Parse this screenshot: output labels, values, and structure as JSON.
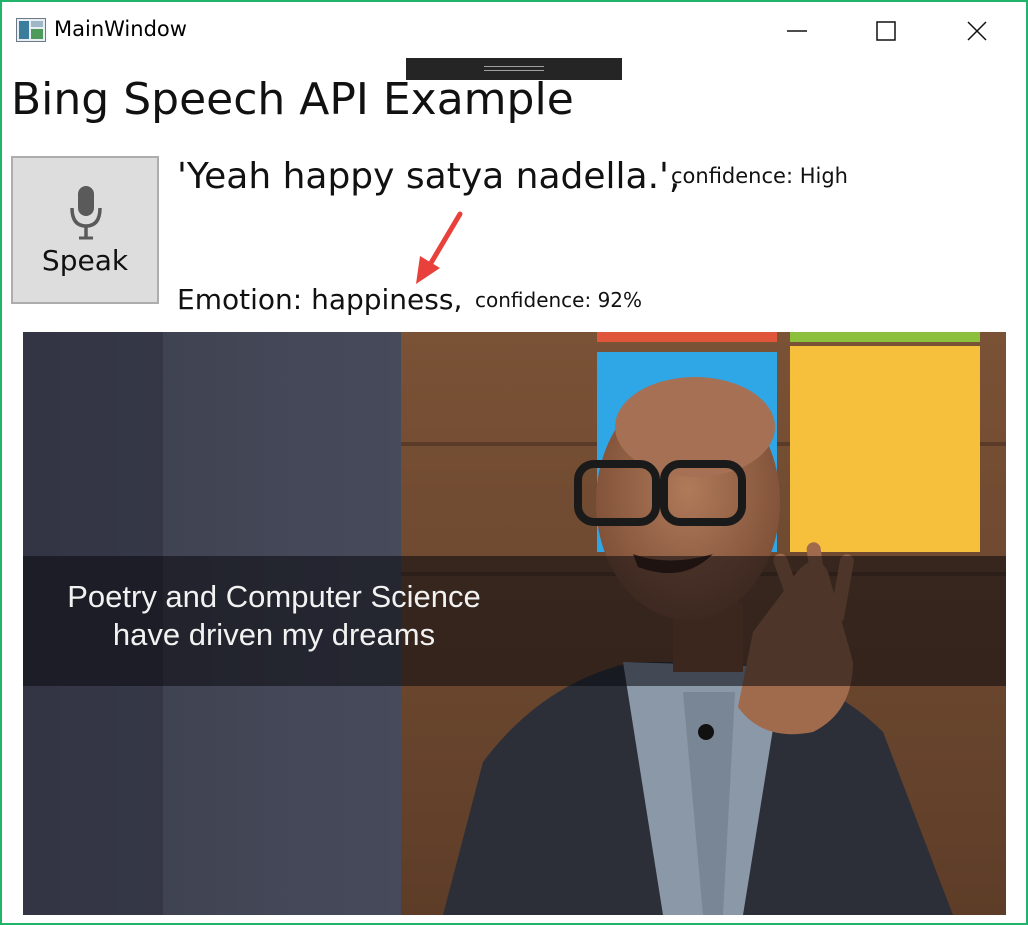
{
  "window": {
    "title": "MainWindow"
  },
  "page": {
    "title": "Bing Speech API Example"
  },
  "speak_button": {
    "label": "Speak",
    "icon": "microphone-icon"
  },
  "speech_result": {
    "text": "'Yeah happy satya nadella.',",
    "confidence": "confidence: High"
  },
  "emotion_result": {
    "text": "Emotion: happiness,",
    "confidence": "confidence: 92%"
  },
  "image": {
    "caption_line1": "Poetry and Computer Science",
    "caption_line2": "have driven my dreams"
  },
  "colors": {
    "window_border": "#21b36a",
    "annotation_arrow": "#e8413c",
    "button_bg": "#dddddd"
  }
}
